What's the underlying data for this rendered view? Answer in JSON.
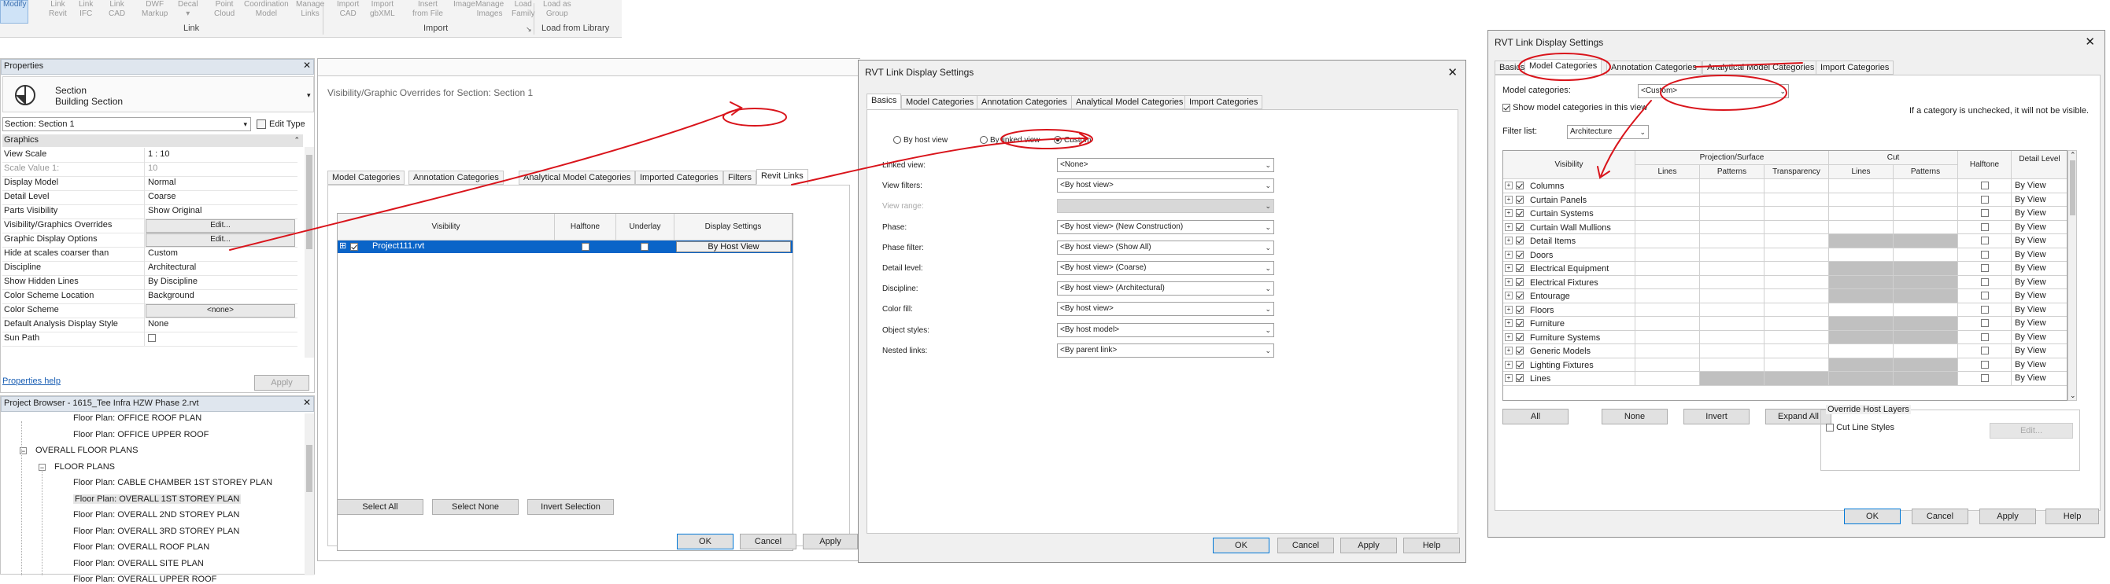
{
  "ribbon": {
    "buttons": [
      {
        "id": "modify",
        "label": "Modify"
      },
      {
        "id": "link-revit",
        "label": "Link\nRevit"
      },
      {
        "id": "link-ifc",
        "label": "Link\nIFC"
      },
      {
        "id": "link-cad",
        "label": "Link\nCAD"
      },
      {
        "id": "dwf-markup",
        "label": "DWF\nMarkup"
      },
      {
        "id": "decal",
        "label": "Decal\n▾"
      },
      {
        "id": "point-cloud",
        "label": "Point\nCloud"
      },
      {
        "id": "coordination-model",
        "label": "Coordination\nModel"
      },
      {
        "id": "manage-links",
        "label": "Manage\nLinks"
      },
      {
        "id": "import-cad",
        "label": "Import\nCAD"
      },
      {
        "id": "import-gbxml",
        "label": "Import\ngbXML"
      },
      {
        "id": "insert-from-file",
        "label": "Insert\nfrom File"
      },
      {
        "id": "image",
        "label": "Image"
      },
      {
        "id": "manage-images",
        "label": "Manage\nImages"
      },
      {
        "id": "load-family",
        "label": "Load\nFamily"
      },
      {
        "id": "load-as-group",
        "label": "Load as\nGroup"
      }
    ],
    "groups": {
      "link": "Link",
      "import": "Import",
      "load_from_library": "Load from Library"
    }
  },
  "properties": {
    "title": "Properties",
    "type_name": "Section",
    "type_sub": "Building Section",
    "selector": "Section: Section 1",
    "edit_type": "Edit Type",
    "group_graphics": "Graphics",
    "rows": [
      {
        "k": "View Scale",
        "v": "1 : 10"
      },
      {
        "k": "Scale Value    1:",
        "v": "10",
        "muted": true
      },
      {
        "k": "Display Model",
        "v": "Normal"
      },
      {
        "k": "Detail Level",
        "v": "Coarse"
      },
      {
        "k": "Parts Visibility",
        "v": "Show Original"
      },
      {
        "k": "Visibility/Graphics Overrides",
        "btn": "Edit..."
      },
      {
        "k": "Graphic Display Options",
        "btn": "Edit..."
      },
      {
        "k": "Hide at scales coarser than",
        "v": "Custom"
      },
      {
        "k": "Discipline",
        "v": "Architectural"
      },
      {
        "k": "Show Hidden Lines",
        "v": "By Discipline"
      },
      {
        "k": "Color Scheme Location",
        "v": "Background"
      },
      {
        "k": "Color Scheme",
        "btn": "<none>"
      },
      {
        "k": "Default Analysis Display Style",
        "v": "None"
      },
      {
        "k": "Sun Path",
        "check": true
      }
    ],
    "help_link": "Properties help",
    "apply": "Apply"
  },
  "project_browser": {
    "title": "Project Browser - 1615_Tee Infra HZW Phase 2.rvt",
    "items": [
      {
        "label": "Floor Plan: OFFICE ROOF PLAN",
        "indent": 3
      },
      {
        "label": "Floor Plan: OFFICE UPPER ROOF",
        "indent": 3
      },
      {
        "label": "OVERALL FLOOR PLANS",
        "indent": 1,
        "tog": "−"
      },
      {
        "label": "FLOOR PLANS",
        "indent": 2,
        "tog": "−"
      },
      {
        "label": "Floor Plan: CABLE CHAMBER 1ST STOREY PLAN",
        "indent": 3
      },
      {
        "label": "Floor Plan: OVERALL 1ST STOREY PLAN",
        "indent": 3,
        "selected": true
      },
      {
        "label": "Floor Plan: OVERALL 2ND STOREY PLAN",
        "indent": 3
      },
      {
        "label": "Floor Plan: OVERALL 3RD STOREY PLAN",
        "indent": 3
      },
      {
        "label": "Floor Plan: OVERALL ROOF PLAN",
        "indent": 3
      },
      {
        "label": "Floor Plan: OVERALL SITE PLAN",
        "indent": 3
      },
      {
        "label": "Floor Plan: OVERALL UPPER ROOF",
        "indent": 3
      }
    ]
  },
  "vg_dialog": {
    "title": "Visibility/Graphic Overrides for Section: Section 1",
    "tabs": [
      "Model Categories",
      "Annotation Categories",
      "Analytical Model Categories",
      "Imported Categories",
      "Filters",
      "Revit Links"
    ],
    "active_tab": 5,
    "columns": [
      "Visibility",
      "Halftone",
      "Underlay",
      "Display Settings"
    ],
    "row": {
      "toggle": "⊞",
      "name": "Project111.rvt",
      "display": "By Host View"
    },
    "buttons": {
      "select_all": "Select All",
      "select_none": "Select None",
      "invert": "Invert Selection",
      "ok": "OK",
      "cancel": "Cancel",
      "apply": "Apply"
    }
  },
  "rld_basics": {
    "title": "RVT Link Display Settings",
    "tabs": [
      "Basics",
      "Model Categories",
      "Annotation Categories",
      "Analytical Model Categories",
      "Import Categories"
    ],
    "active_tab": 0,
    "radios": [
      {
        "label": "By host view",
        "on": false
      },
      {
        "label": "By linked view",
        "on": false
      },
      {
        "label": "Custom",
        "on": true
      }
    ],
    "fields": [
      {
        "label": "Linked view:",
        "value": "<None>"
      },
      {
        "label": "View filters:",
        "value": "<By host view>"
      },
      {
        "label": "View range:",
        "value": "",
        "disabled": true
      },
      {
        "label": "Phase:",
        "value": "<By host view> (New Construction)"
      },
      {
        "label": "Phase filter:",
        "value": "<By host view> (Show All)"
      },
      {
        "label": "Detail level:",
        "value": "<By host view> (Coarse)"
      },
      {
        "label": "Discipline:",
        "value": "<By host view> (Architectural)"
      },
      {
        "label": "Color fill:",
        "value": "<By host view>"
      },
      {
        "label": "Object styles:",
        "value": "<By host model>"
      },
      {
        "label": "Nested links:",
        "value": "<By parent link>"
      }
    ],
    "buttons": {
      "ok": "OK",
      "cancel": "Cancel",
      "apply": "Apply",
      "help": "Help"
    }
  },
  "rld_model": {
    "title": "RVT Link Display Settings",
    "tabs": [
      "Basics",
      "Model Categories",
      "Annotation Categories",
      "Analytical Model Categories",
      "Import Categories"
    ],
    "active_tab": 1,
    "model_categories_label": "Model categories:",
    "model_categories_value": "<Custom>",
    "show_label": "Show model categories in this view",
    "unchecked_note": "If a category is unchecked, it will not be visible.",
    "filter_label": "Filter list:",
    "filter_value": "Architecture",
    "headers": {
      "visibility": "Visibility",
      "projection_surface": "Projection/Surface",
      "cut": "Cut",
      "halftone": "Halftone",
      "detail_level": "Detail Level",
      "lines": "Lines",
      "patterns": "Patterns",
      "transparency": "Transparency",
      "cut_lines": "Lines",
      "cut_patterns": "Patterns"
    },
    "rows": [
      {
        "name": "Columns",
        "cut_gray": false,
        "proj_gray": false
      },
      {
        "name": "Curtain Panels",
        "cut_gray": false,
        "proj_gray": false
      },
      {
        "name": "Curtain Systems",
        "cut_gray": false,
        "proj_gray": false
      },
      {
        "name": "Curtain Wall Mullions",
        "cut_gray": false,
        "proj_gray": false
      },
      {
        "name": "Detail Items",
        "cut_gray": true,
        "proj_gray": false
      },
      {
        "name": "Doors",
        "cut_gray": false,
        "proj_gray": false
      },
      {
        "name": "Electrical Equipment",
        "cut_gray": true,
        "proj_gray": false
      },
      {
        "name": "Electrical Fixtures",
        "cut_gray": true,
        "proj_gray": false
      },
      {
        "name": "Entourage",
        "cut_gray": true,
        "proj_gray": false
      },
      {
        "name": "Floors",
        "cut_gray": false,
        "proj_gray": false
      },
      {
        "name": "Furniture",
        "cut_gray": true,
        "proj_gray": false
      },
      {
        "name": "Furniture Systems",
        "cut_gray": true,
        "proj_gray": false
      },
      {
        "name": "Generic Models",
        "cut_gray": false,
        "proj_gray": false
      },
      {
        "name": "Lighting Fixtures",
        "cut_gray": true,
        "proj_gray": false
      },
      {
        "name": "Lines",
        "cut_gray": true,
        "proj_gray": true
      }
    ],
    "by_view": "By View",
    "buttons": {
      "all": "All",
      "none": "None",
      "invert": "Invert",
      "expand_all": "Expand All",
      "ok": "OK",
      "cancel": "Cancel",
      "apply": "Apply",
      "help": "Help",
      "edit": "Edit..."
    },
    "override_title": "Override Host Layers",
    "cut_line_styles": "Cut Line Styles"
  },
  "colors": {
    "annotation_red": "#d9141b",
    "selection_blue": "#0a64c8",
    "panel_header": "#dfe6ee"
  }
}
